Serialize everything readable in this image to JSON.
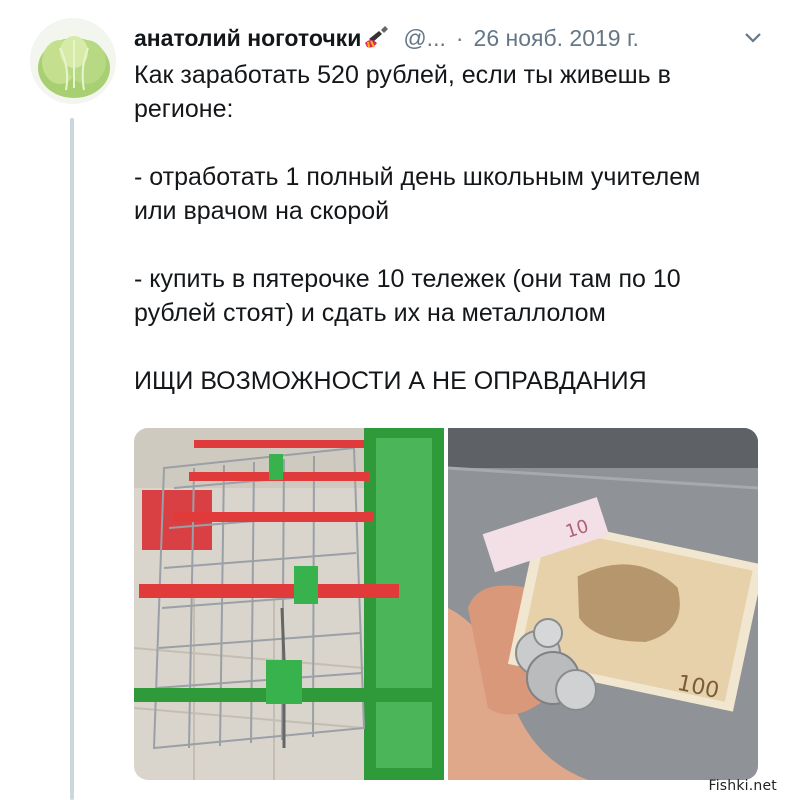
{
  "author": {
    "name": "анатолий ноготочки",
    "name_emoji_icon": "nail-polish-icon",
    "handle": "@...",
    "date": "26 нояб. 2019 г.",
    "avatar_icon": "cabbage-avatar"
  },
  "menu": {
    "icon": "chevron-down-icon"
  },
  "tweet": {
    "lines": [
      "Как заработать 520 рублей, если ты живешь в",
      "регионе:",
      "",
      "- отработать 1 полный день школьным учителем",
      "или врачом на скорой",
      "",
      "- купить в пятерочке 10 тележек (они там по 10",
      "рублей стоят) и сдать их на металлолом",
      "",
      "ИЩИ ВОЗМОЖНОСТИ А НЕ ОПРАВДАНИЯ"
    ]
  },
  "media": {
    "photos": [
      "shopping-carts-photo",
      "money-in-hand-photo"
    ]
  },
  "watermark": "Fishki.net",
  "colors": {
    "text": "#14171a",
    "secondary": "#657786",
    "thread_line": "#ccd6dd"
  }
}
